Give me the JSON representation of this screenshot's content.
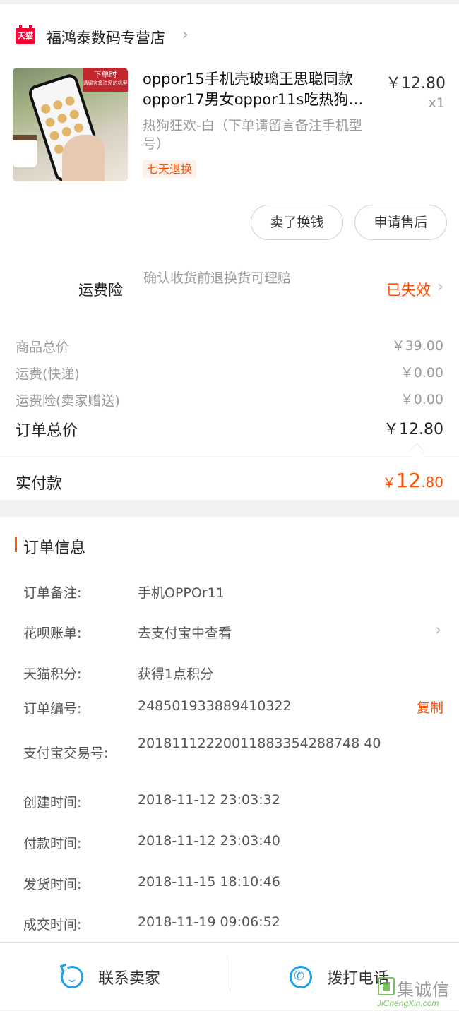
{
  "store": {
    "logo_text": "天猫",
    "name": "福鸿泰数码专营店"
  },
  "product": {
    "image_tag_line1": "下单时",
    "image_tag_line2": "请留言备注您的机型",
    "title_line1": "oppor15手机壳玻璃王思聪同款",
    "title_line2": "oppor17男女oppor11s吃热狗…",
    "price": "￥12.80",
    "quantity": "x1",
    "sku": "热狗狂欢-白（下单请留言备注手机型号）",
    "badge": "七天退换"
  },
  "actions": {
    "sell": "卖了换钱",
    "after_sale": "申请售后"
  },
  "insurance": {
    "label": "运费险",
    "description": "确认收货前退换货可理赔",
    "status": "已失效"
  },
  "summary": {
    "rows": [
      {
        "label": "商品总价",
        "value": "￥39.00"
      },
      {
        "label": "运费(快递)",
        "value": "￥0.00"
      },
      {
        "label": "运费险(卖家赠送)",
        "value": "￥0.00"
      }
    ],
    "total_label": "订单总价",
    "total_value": "￥12.80",
    "paid_label": "实付款",
    "paid_currency": "￥",
    "paid_int": "12",
    "paid_dec": ".80"
  },
  "order_info": {
    "title": "订单信息",
    "note_label": "订单备注:",
    "note_value": "手机OPPOr11",
    "huabei_label": "花呗账单:",
    "huabei_value": "去支付宝中查看",
    "points_label": "天猫积分:",
    "points_value": "获得1点积分",
    "order_no_label": "订单编号:",
    "order_no_value": "248501933889410322",
    "copy_label": "复制",
    "alipay_label": "支付宝交易号:",
    "alipay_value": "20181112220011883354288748 40",
    "created_label": "创建时间:",
    "created_value": "2018-11-12 23:03:32",
    "paid_time_label": "付款时间:",
    "paid_time_value": "2018-11-12 23:03:40",
    "shipped_label": "发货时间:",
    "shipped_value": "2018-11-15 18:10:46",
    "completed_label": "成交时间:",
    "completed_value": "2018-11-19 09:06:52"
  },
  "bottom_bar": {
    "contact": "联系卖家",
    "call": "拨打电话"
  },
  "watermark": {
    "cn": "集诚信",
    "en": "JiChengXin.com"
  },
  "colors": {
    "accent": "#ff5000",
    "tmall_red": "#ff0036",
    "link_blue": "#1aa3e8"
  }
}
